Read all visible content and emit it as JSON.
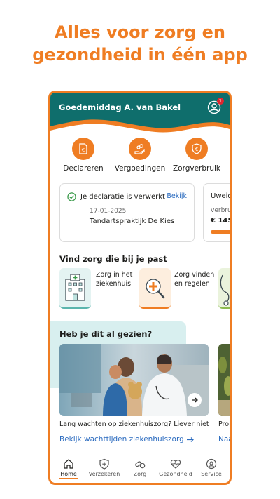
{
  "promo": {
    "headline_line1": "Alles voor zorg en",
    "headline_line2": "gezondheid in één app"
  },
  "header": {
    "greeting": "Goedemiddag A. van Bakel",
    "notification_count": "1"
  },
  "quick_actions": [
    {
      "label": "Declareren",
      "icon": "euro-document-icon"
    },
    {
      "label": "Vergoedingen",
      "icon": "hand-coins-icon"
    },
    {
      "label": "Zorgverbruik",
      "icon": "euro-shield-icon"
    }
  ],
  "declaration_card": {
    "title": "Je declaratie is verwerkt",
    "link": "Bekijk",
    "date": "17-01-2025",
    "provider": "Tandartspraktijk De Kies"
  },
  "usage_card": {
    "title": "Uweig",
    "subtitle": "verbruik",
    "amount": "€ 145,"
  },
  "find_care": {
    "title": "Vind zorg die bij je past",
    "tiles": [
      {
        "line1": "Zorg in het",
        "line2": "ziekenhuis",
        "icon": "hospital-icon"
      },
      {
        "line1": "Zorg vinden",
        "line2": "en regelen",
        "icon": "magnifier-cross-icon"
      },
      {
        "line1": "",
        "line2": "",
        "icon": "stethoscope-icon"
      }
    ]
  },
  "seen": {
    "title": "Heb je dit al gezien?",
    "caption": "Lang wachten op ziekenhuiszorg? Liever niet",
    "link": "Bekijk wachttijden ziekenhuiszorg",
    "caption2": "Prob",
    "link2": "Naa"
  },
  "tabs": [
    {
      "label": "Home",
      "icon": "home-icon",
      "active": true
    },
    {
      "label": "Verzekeren",
      "icon": "shield-plus-icon"
    },
    {
      "label": "Zorg",
      "icon": "pills-icon"
    },
    {
      "label": "Gezondheid",
      "icon": "heart-pulse-icon"
    },
    {
      "label": "Service",
      "icon": "chat-service-icon"
    }
  ],
  "colors": {
    "brand_orange": "#ef7d23",
    "teal": "#0f6e6c",
    "link_blue": "#2b6bbf",
    "light_teal": "#d8efef"
  }
}
